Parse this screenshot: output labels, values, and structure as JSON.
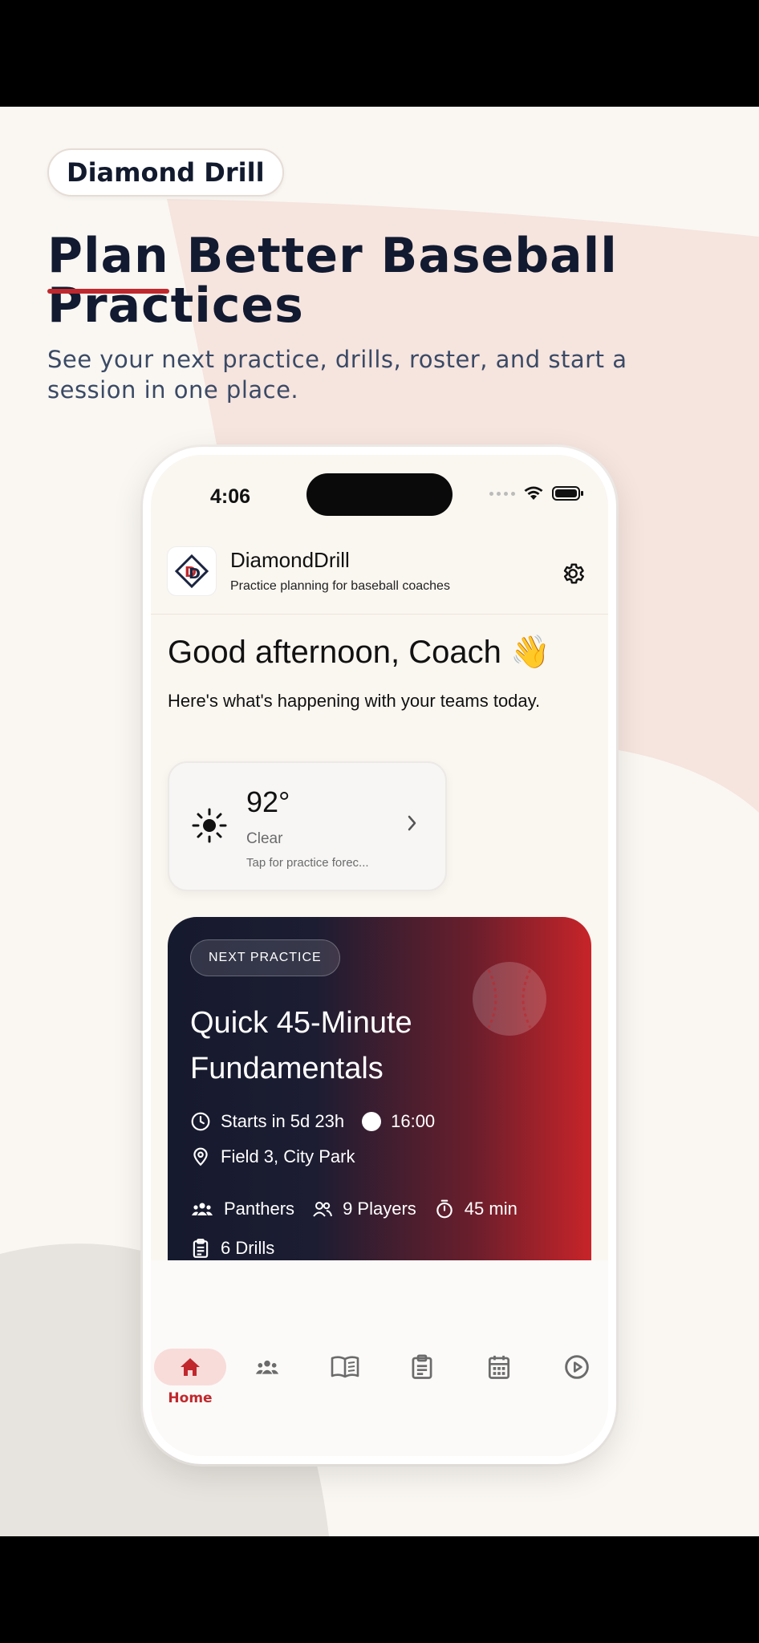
{
  "brand": {
    "name": "Diamond Drill"
  },
  "headline": {
    "first_word": "Plan",
    "rest": " Better Baseball Practices"
  },
  "subheadline": "See your next practice, drills, roster, and start a session in one place.",
  "status_bar": {
    "time": "4:06"
  },
  "app": {
    "name": "DiamondDrill",
    "tagline": "Practice planning for baseball coaches"
  },
  "greeting": {
    "title": "Good afternoon, Coach 👋",
    "subtitle": "Here's what's happening with your teams today."
  },
  "weather": {
    "temperature": "92°",
    "condition": "Clear",
    "hint": "Tap for practice forec..."
  },
  "next_practice": {
    "tag": "NEXT PRACTICE",
    "title": "Quick 45-Minute Fundamentals",
    "starts_in": "Starts in 5d 23h",
    "time": "16:00",
    "location": "Field 3, City Park",
    "team": "Panthers",
    "players": "9 Players",
    "duration": "45 min",
    "drills": "6 Drills"
  },
  "tabs": [
    {
      "label": "Home",
      "icon": "home-icon",
      "active": true
    },
    {
      "label": "",
      "icon": "team-icon"
    },
    {
      "label": "",
      "icon": "book-icon"
    },
    {
      "label": "",
      "icon": "clipboard-icon"
    },
    {
      "label": "",
      "icon": "calendar-icon"
    },
    {
      "label": "",
      "icon": "play-icon"
    }
  ],
  "colors": {
    "accent": "#c0282d",
    "navy": "#111a30",
    "card_dark": "#161a2e"
  }
}
